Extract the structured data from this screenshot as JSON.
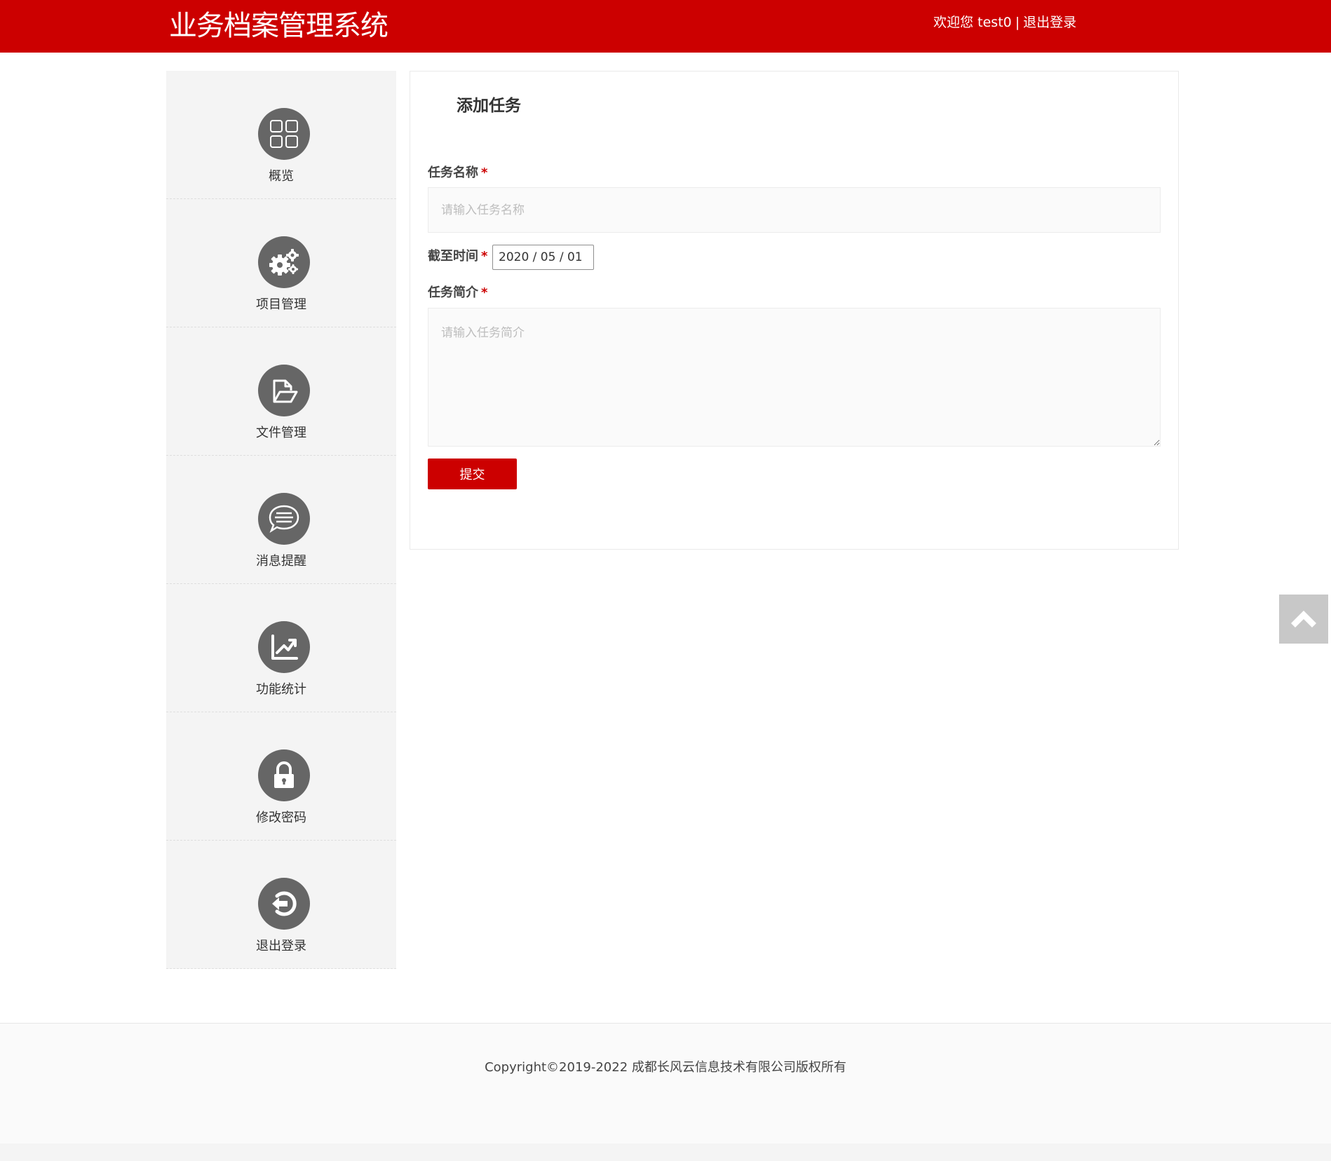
{
  "header": {
    "title": "业务档案管理系统",
    "welcome": "欢迎您 test0",
    "separator": "|",
    "logout_label": "退出登录"
  },
  "sidebar": {
    "items": [
      {
        "label": "概览",
        "icon": "grid-icon"
      },
      {
        "label": "项目管理",
        "icon": "gears-icon"
      },
      {
        "label": "文件管理",
        "icon": "folder-open-icon"
      },
      {
        "label": "消息提醒",
        "icon": "chat-bubble-icon"
      },
      {
        "label": "功能统计",
        "icon": "line-chart-icon"
      },
      {
        "label": "修改密码",
        "icon": "lock-icon"
      },
      {
        "label": "退出登录",
        "icon": "sign-out-icon"
      }
    ]
  },
  "form": {
    "title": "添加任务",
    "task_name_label": "任务名称",
    "task_name_placeholder": "请输入任务名称",
    "deadline_label": "截至时间",
    "deadline_value": "2020 / 05 / 01",
    "description_label": "任务简介",
    "description_placeholder": "请输入任务简介",
    "required_mark": "*",
    "submit_label": "提交"
  },
  "footer": {
    "copyright": "Copyright©2019-2022  成都长风云信息技术有限公司版权所有"
  },
  "colors": {
    "brand": "#cc0000",
    "icon_bg": "#666666",
    "sidebar_bg": "#f4f4f4"
  }
}
